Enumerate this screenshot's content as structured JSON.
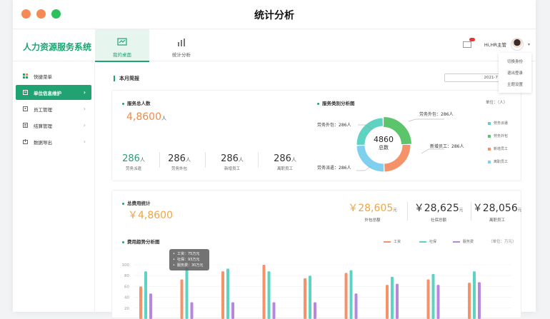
{
  "window": {
    "title": "统计分析"
  },
  "brand": "人力资源服务系统",
  "nav": [
    {
      "label": "我的桌面",
      "icon": "chart-line-icon"
    },
    {
      "label": "统计分析",
      "icon": "bar-chart-icon"
    }
  ],
  "user": {
    "name": "Hi,HR主管"
  },
  "dropdown": [
    "切换身份",
    "退出登录",
    "主题设置"
  ],
  "sidebar": [
    {
      "label": "快捷菜单",
      "icon": "grid-icon"
    },
    {
      "label": "单位信息维护",
      "icon": "building-icon"
    },
    {
      "label": "员工管理",
      "icon": "person-icon"
    },
    {
      "label": "结算管理",
      "icon": "document-icon"
    },
    {
      "label": "数据导出",
      "icon": "export-icon"
    }
  ],
  "report": {
    "title": "本月简报",
    "date": "2021-7"
  },
  "service_total": {
    "title": "服务总人数",
    "value": "4,8600",
    "unit": "人",
    "stats": [
      {
        "value": "286",
        "unit": "人",
        "label": "劳务派遣"
      },
      {
        "value": "286",
        "unit": "人",
        "label": "劳务外包"
      },
      {
        "value": "286",
        "unit": "人",
        "label": "新增员工"
      },
      {
        "value": "286",
        "unit": "人",
        "label": "离职员工"
      }
    ]
  },
  "donut": {
    "title": "服务类别分析图",
    "unit_label": "单位：（人）",
    "center_value": "4860",
    "center_label": "总数",
    "labels": [
      "劳务外包：286人",
      "劳务外包：286人",
      "新增员工：286人",
      "劳务派遣：286人"
    ],
    "legend": [
      {
        "label": "劳务派遣",
        "color": "#5ed3c2"
      },
      {
        "label": "劳务外包",
        "color": "#5cc46b"
      },
      {
        "label": "新增员工",
        "color": "#f5926a"
      },
      {
        "label": "离职员工",
        "color": "#7fd0ee"
      }
    ]
  },
  "cost": {
    "title": "总费用统计",
    "value": "￥4,8600",
    "stats": [
      {
        "value": "￥28,605",
        "unit": "元",
        "label": "外包总额",
        "orange": true
      },
      {
        "value": "￥28,625",
        "unit": "元",
        "label": "社保总额",
        "orange": false
      },
      {
        "value": "￥28,056",
        "unit": "元",
        "label": "离职员工",
        "orange": false
      }
    ]
  },
  "trend": {
    "title": "费用趋势分析图",
    "unit_label": "（单位：万元）",
    "tooltip": [
      "工资：75万元",
      "社保：93万元",
      "服务费：30万元"
    ]
  },
  "chart_data": {
    "type": "bar",
    "yticks": [
      "100",
      "80",
      "60",
      "40",
      "20"
    ],
    "ylim": [
      0,
      100
    ],
    "series": [
      {
        "name": "工资",
        "color": "#f5926a",
        "values": [
          60,
          73,
          88,
          100,
          75,
          85,
          63,
          73,
          67
        ]
      },
      {
        "name": "社保",
        "color": "#5ed3c2",
        "values": [
          88,
          95,
          93,
          88,
          80,
          90,
          78,
          83,
          88
        ]
      },
      {
        "name": "服务费",
        "color": "#b787e0",
        "values": [
          47,
          31,
          31,
          31,
          31,
          47,
          65,
          63,
          68
        ]
      }
    ],
    "donut_values": [
      286,
      286,
      286,
      286
    ]
  }
}
